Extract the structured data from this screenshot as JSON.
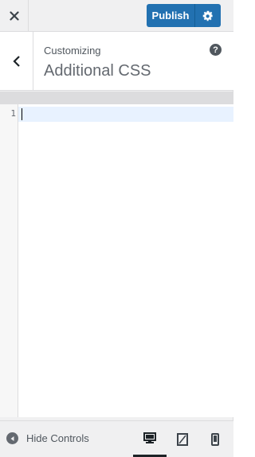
{
  "header": {
    "close_icon": "close-icon",
    "publish_label": "Publish",
    "settings_icon": "gear-icon"
  },
  "section": {
    "back_icon": "chevron-left-icon",
    "customizing": "Customizing",
    "title": "Additional CSS",
    "help_glyph": "?"
  },
  "editor": {
    "line_numbers": [
      "1"
    ],
    "content": ""
  },
  "footer": {
    "hide_controls_label": "Hide Controls",
    "devices": [
      "desktop",
      "tablet",
      "mobile"
    ],
    "active_device": "desktop"
  },
  "colors": {
    "accent": "#2271b1",
    "active_line": "#e8f2ff"
  }
}
